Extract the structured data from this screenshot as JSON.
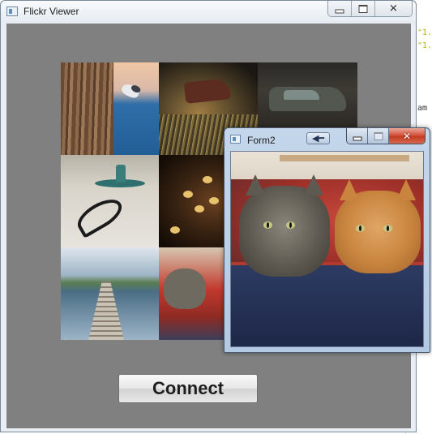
{
  "background_editor": {
    "snippets": [
      "\"1.",
      "\"1.",
      "am"
    ]
  },
  "main_window": {
    "title": "Flickr Viewer",
    "icon": "app-window-icon",
    "caption_buttons": [
      "minimize-icon",
      "maximize-icon",
      "close-icon"
    ],
    "client_background": "#808080",
    "photo_grid": {
      "tiles": [
        {
          "subject": "tree-bark"
        },
        {
          "subject": "nuthatch-bird"
        },
        {
          "subject": "wheelbarrow"
        },
        {
          "subject": "vintage-car"
        },
        {
          "subject": "candle-holder-and-scissors"
        },
        {
          "subject": "cookies"
        },
        {
          "subject": "lake-dock"
        },
        {
          "subject": "cats-on-bed"
        }
      ]
    },
    "connect_button": {
      "label": "Connect"
    }
  },
  "form2": {
    "title": "Form2",
    "icon": "app-window-icon",
    "back_button_icon": "arrow-left-icon",
    "caption_buttons": [
      "minimize-icon",
      "maximize-icon",
      "close-icon"
    ],
    "close_color": "#c23c22",
    "photo": {
      "subject": "two-cats-on-bed"
    }
  }
}
